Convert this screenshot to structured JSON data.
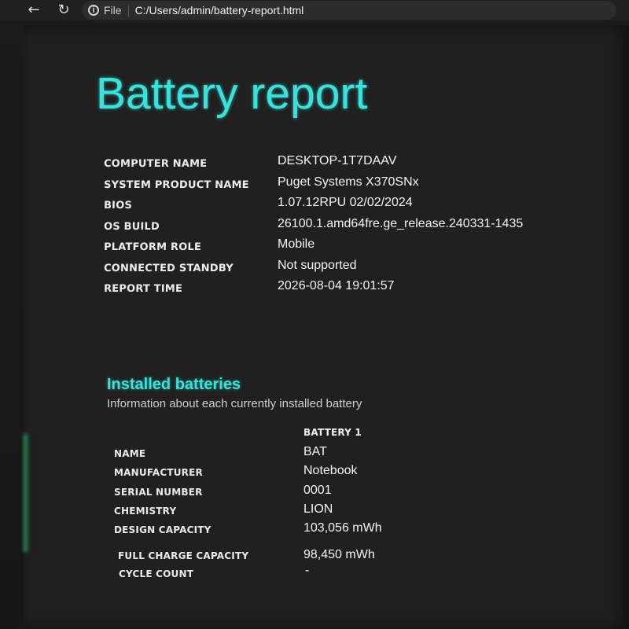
{
  "browser": {
    "back_icon": "arrow-left-icon",
    "reload_icon": "refresh-icon",
    "scheme": "File",
    "url": "C:/Users/admin/battery-report.html"
  },
  "report": {
    "title": "Battery report",
    "summary": [
      {
        "label": "COMPUTER NAME",
        "value": "DESKTOP-1T7DAAV"
      },
      {
        "label": "SYSTEM PRODUCT NAME",
        "value": "Puget Systems X370SNx"
      },
      {
        "label": "BIOS",
        "value": "1.07.12RPU 02/02/2024"
      },
      {
        "label": "OS BUILD",
        "value": "26100.1.amd64fre.ge_release.240331-1435"
      },
      {
        "label": "PLATFORM ROLE",
        "value": "Mobile"
      },
      {
        "label": "CONNECTED STANDBY",
        "value": "Not supported"
      },
      {
        "label": "REPORT TIME",
        "value": "2026-08-04  19:01:57"
      }
    ],
    "installed_batteries": {
      "title": "Installed batteries",
      "subtitle": "Information about each currently installed battery",
      "column_header": "BATTERY 1",
      "rows": [
        {
          "label": "NAME",
          "value": "BAT"
        },
        {
          "label": "MANUFACTURER",
          "value": "Notebook"
        },
        {
          "label": "SERIAL NUMBER",
          "value": "0001"
        },
        {
          "label": "CHEMISTRY",
          "value": "LION"
        },
        {
          "label": "DESIGN CAPACITY",
          "value": "103,056 mWh"
        },
        {
          "label": "FULL CHARGE CAPACITY",
          "value": "98,450 mWh"
        },
        {
          "label": "CYCLE COUNT",
          "value": "-"
        }
      ]
    }
  },
  "colors": {
    "accent": "#39e3dd",
    "background": "#202020",
    "text": "#f4f4f4"
  }
}
